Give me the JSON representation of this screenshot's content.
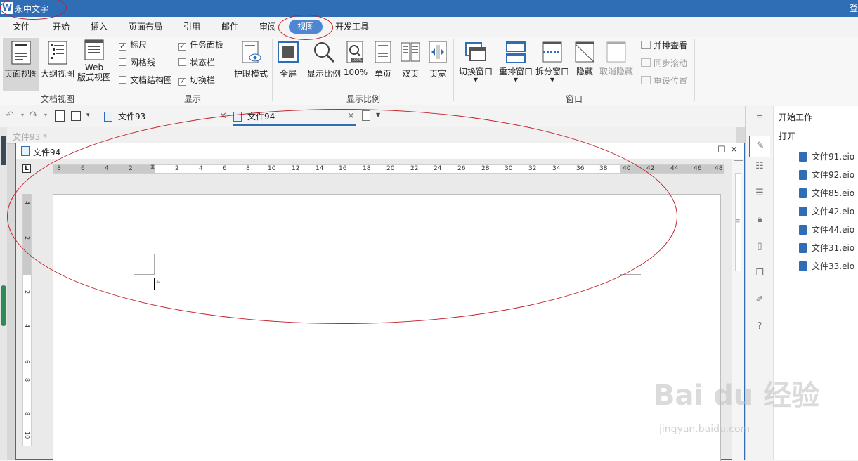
{
  "titlebar": {
    "logo": "W",
    "title": "永中文字",
    "right_char": "登"
  },
  "menu": [
    "文件",
    "开始",
    "插入",
    "页面布局",
    "引用",
    "邮件",
    "审阅",
    "视图",
    "开发工具"
  ],
  "ribbon": {
    "doc_view": {
      "page_view": "页面视图",
      "outline_view": "大纲视图",
      "web_view_1": "Web",
      "web_view_2": "版式视图",
      "group": "文档视图"
    },
    "show": {
      "ruler": "标尺",
      "grid": "网格线",
      "doc_structure": "文档结构图",
      "task_pane": "任务面板",
      "status_bar": "状态栏",
      "switch_bar": "切换栏",
      "group": "显示",
      "ruler_checked": true,
      "grid_checked": false,
      "doc_structure_checked": false,
      "task_pane_checked": true,
      "status_bar_checked": false,
      "switch_bar_checked": true
    },
    "eye_mode": "护眼模式",
    "zoom": {
      "fullscreen": "全屏",
      "zoom_ratio": "显示比例",
      "hundred": "100%",
      "single": "单页",
      "double": "双页",
      "page_width": "页宽",
      "group": "显示比例",
      "hundred_icon": "100%"
    },
    "window": {
      "switch": "切换窗口",
      "rearrange": "重排窗口",
      "split": "拆分窗口",
      "hide": "隐藏",
      "unhide": "取消隐藏",
      "side_by_side": "并排查看",
      "sync_scroll": "同步滚动",
      "reset_pos": "重设位置",
      "group": "窗口"
    }
  },
  "tabs": [
    {
      "label": "文件93"
    },
    {
      "label": "文件94"
    }
  ],
  "windows": {
    "back_title": "文件93 *",
    "front_title": "文件94"
  },
  "ruler": {
    "h_left": [
      "8",
      "6",
      "4",
      "2"
    ],
    "h_right": [
      "2",
      "4",
      "6",
      "8",
      "10",
      "12",
      "14",
      "16",
      "18",
      "20",
      "22",
      "24",
      "26",
      "28",
      "30",
      "32",
      "34",
      "36",
      "38",
      "40",
      "42",
      "44",
      "46",
      "48"
    ],
    "v_numbers": [
      "4",
      "2",
      "2",
      "4",
      "6",
      "8",
      "8",
      "10"
    ],
    "outer_v_numbers": [
      "4",
      "2",
      "2",
      "4",
      "6",
      "8",
      "8",
      "10"
    ]
  },
  "taskpane": {
    "title": "开始工作",
    "open": "打开",
    "files": [
      "文件91.eio",
      "文件92.eio",
      "文件85.eio",
      "文件42.eio",
      "文件44.eio",
      "文件31.eio",
      "文件33.eio"
    ]
  },
  "watermark": {
    "main": "Bai du 经验",
    "sub": "jingyan.baidu.com"
  },
  "colors": {
    "accent": "#2f6db5",
    "active_tab": "#4e86d2",
    "annotation": "#c0202a"
  }
}
